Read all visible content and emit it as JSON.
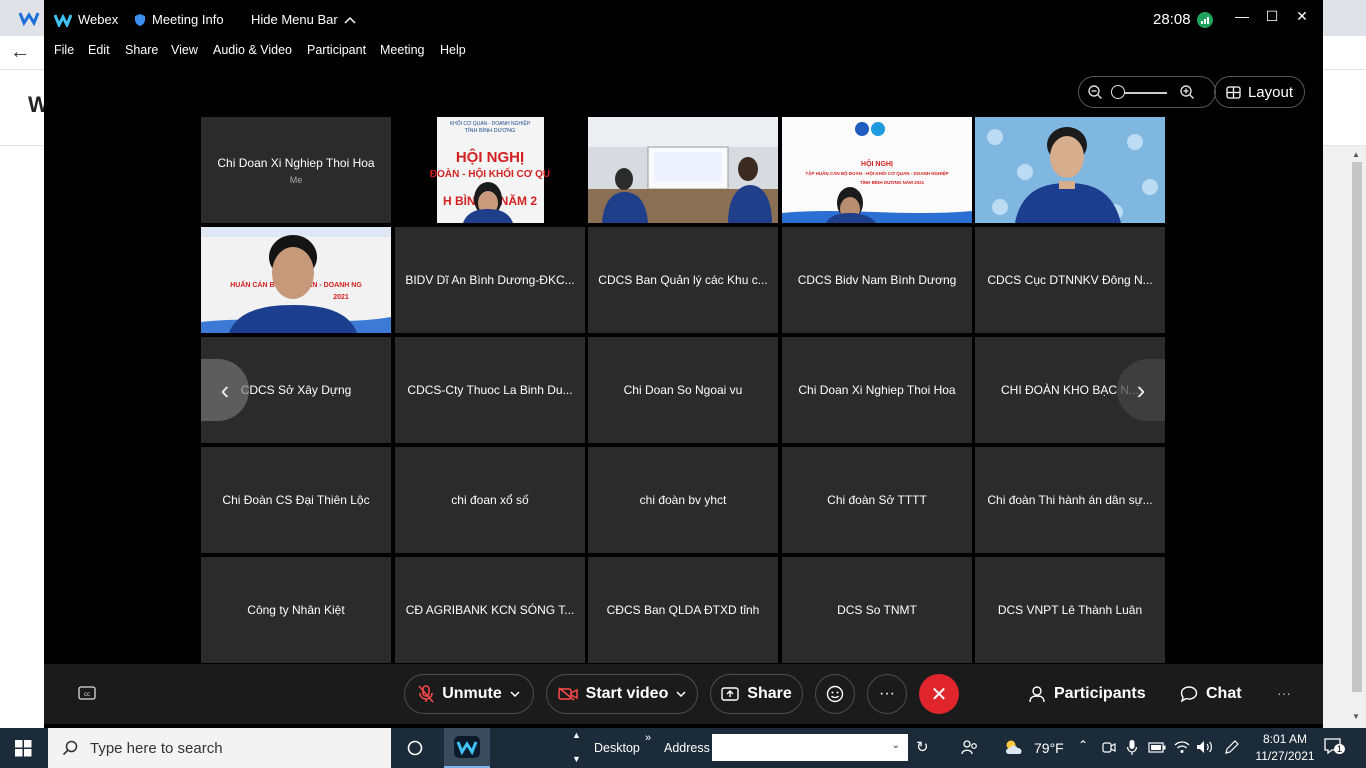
{
  "window": {
    "app_name": "Webex",
    "meeting_info": "Meeting Info",
    "hide_menu": "Hide Menu Bar",
    "timer": "28:08"
  },
  "menu": [
    "File",
    "Edit",
    "Share",
    "View",
    "Audio & Video",
    "Participant",
    "Meeting",
    "Help"
  ],
  "layout_label": "Layout",
  "tiles": [
    {
      "name": "Chi Doan Xi Nghiep Thoi Hoa",
      "sub": "Me",
      "video": false
    },
    {
      "name": "",
      "video": true,
      "scene": "hoi-nghi-1"
    },
    {
      "name": "",
      "video": true,
      "scene": "meeting-room"
    },
    {
      "name": "",
      "video": true,
      "scene": "hoi-nghi-2"
    },
    {
      "name": "",
      "video": true,
      "scene": "person-blue"
    },
    {
      "name": "",
      "video": true,
      "scene": "person-banner"
    },
    {
      "name": "BIDV Dĩ An Bình Dương-ĐKC..."
    },
    {
      "name": "CDCS Ban Quản lý các Khu c..."
    },
    {
      "name": "CDCS Bidv Nam Bình Dương"
    },
    {
      "name": "CDCS Cục DTNNKV Đông N..."
    },
    {
      "name": "CDCS Sở Xây Dựng"
    },
    {
      "name": "CDCS-Cty Thuoc La Binh Du..."
    },
    {
      "name": "Chi Doan So Ngoai vu"
    },
    {
      "name": "Chi Doan Xi Nghiep Thoi Hoa"
    },
    {
      "name": "CHI ĐOÀN KHO BẠC N..."
    },
    {
      "name": "Chi Đoàn CS Đại Thiên Lộc"
    },
    {
      "name": "chi đoan xổ số"
    },
    {
      "name": "chi đoàn bv yhct"
    },
    {
      "name": "Chi đoàn Sở TTTT"
    },
    {
      "name": "Chi đoàn Thi hành án dân sự..."
    },
    {
      "name": "Công ty Nhân Kiệt"
    },
    {
      "name": "CĐ AGRIBANK KCN SÓNG T..."
    },
    {
      "name": "CĐCS Ban QLDA ĐTXD tỉnh"
    },
    {
      "name": "DCS So TNMT"
    },
    {
      "name": "DCS VNPT Lê Thành Luân"
    }
  ],
  "video_text": {
    "banner1_top": "KHỐI CƠ QUAN - DOANH NGHIỆP",
    "banner1_sub": "TỈNH BÌNH DƯƠNG",
    "banner1_title": "HỘI NGHỊ",
    "banner1_line2": "ĐOÀN - HỘI KHỐI CƠ QU",
    "banner1_line3": "H BÌNH D NĂM 2",
    "banner2_title": "HỘI NGHỊ",
    "banner2_line": "TẬP HUẤN CÁN BỘ ĐOÀN - HỘI KHỐI CƠ QUAN - DOANH NGHIỆP",
    "banner2_line3": "TỈNH BÌNH DƯƠNG NĂM 2021",
    "banner3_line": "HUẤN CÁN BỘ Đ    Ơ QUAN - DOANH NG",
    "banner3_year": "2021"
  },
  "controls": {
    "unmute": "Unmute",
    "start_video": "Start video",
    "share": "Share",
    "participants": "Participants",
    "chat": "Chat"
  },
  "taskbar": {
    "search_placeholder": "Type here to search",
    "desktop": "Desktop",
    "address": "Address",
    "temperature": "79°F",
    "time": "8:01 AM",
    "date": "11/27/2021",
    "notif_count": "1"
  },
  "colors": {
    "accent_red": "#e0252d",
    "tile_bg": "#2b2b2b",
    "taskbar": "#1c2b3a"
  }
}
